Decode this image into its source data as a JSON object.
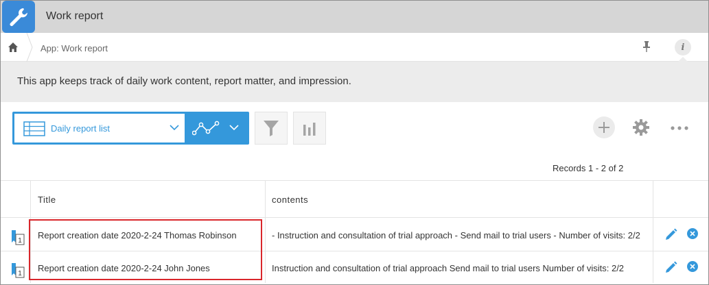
{
  "app": {
    "title": "Work report",
    "icon": "wrench-icon"
  },
  "breadcrumb": {
    "home_icon": "home-icon",
    "current": "App: Work report"
  },
  "header_actions": {
    "pin_icon": "pin-icon",
    "info_label": "i"
  },
  "description": "This app keeps track of daily work content, report matter, and impression.",
  "toolbar": {
    "view_label": "Daily report list",
    "view_icon": "list-icon",
    "graph_icon": "line-graph-icon",
    "filter_icon": "funnel-icon",
    "chart_icon": "bar-chart-icon",
    "add_icon": "plus-icon",
    "settings_icon": "gear-icon",
    "more_icon": "more-dots-icon"
  },
  "records_count": "Records 1 - 2 of 2",
  "table": {
    "columns": [
      "Title",
      "contents"
    ],
    "rows": [
      {
        "detail_number": "1",
        "title": "Report creation date 2020-2-24 Thomas Robinson",
        "contents": "- Instruction and consultation of trial approach - Send mail to trial users - Number of visits: 2/2"
      },
      {
        "detail_number": "1",
        "title": "Report creation date 2020-2-24 John Jones",
        "contents": "Instruction and consultation of trial approach Send mail to trial users Number of visits: 2/2"
      }
    ]
  },
  "colors": {
    "accent": "#3498db",
    "header_bg": "#d6d6d6",
    "highlight": "#d9262b"
  }
}
